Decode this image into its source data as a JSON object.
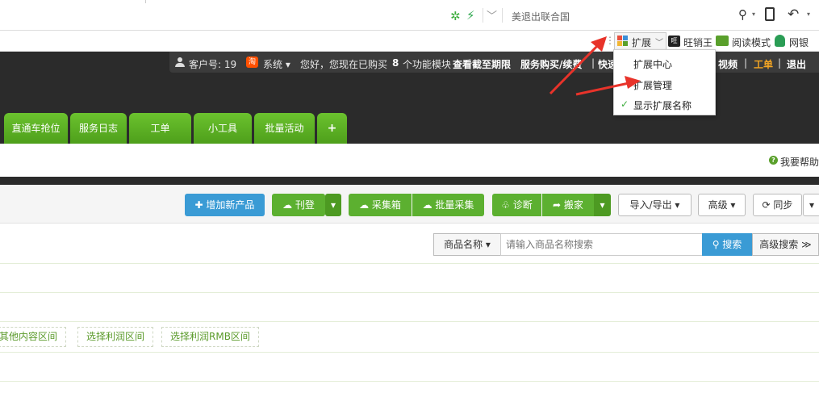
{
  "browser": {
    "search_text": "美退出联合国"
  },
  "extbar": {
    "ext_label": "扩展",
    "wangxiao": "旺销王",
    "read_mode": "阅读模式",
    "wangyin": "网银"
  },
  "ext_menu": {
    "items": [
      "扩展中心",
      "扩展管理",
      "显示扩展名称"
    ]
  },
  "infobar": {
    "customer": "客户号: 19",
    "system": "系统 ▾",
    "greeting": "您好，您现在已购买",
    "count": "8",
    "module_text": "个功能模块",
    "check_expiry": "查看截至期限",
    "service": "服务购买/续费",
    "quick": "快速",
    "video": "视频",
    "ticket": "工单",
    "logout": "退出",
    "sep": "|"
  },
  "tabs": [
    "直通车抢位",
    "服务日志",
    "工单",
    "小工具",
    "批量活动",
    "+"
  ],
  "help": "我要帮助",
  "toolbar": {
    "add_product": "增加新产品",
    "publish": "刊登",
    "collect_box": "采集箱",
    "batch_collect": "批量采集",
    "diagnose": "诊断",
    "move": "搬家",
    "import_export": "导入/导出 ▾",
    "advanced": "高级 ▾",
    "sync": "同步"
  },
  "search": {
    "field_select": "商品名称 ▾",
    "placeholder": "请输入商品名称搜索",
    "button": "搜索",
    "advanced": "高级搜索 ≫"
  },
  "filters": [
    "其他内容区间",
    "选择利润区间",
    "选择利润RMB区间"
  ],
  "colors": {
    "green": "#5cb030",
    "blue": "#3a9bd5",
    "dark": "#2b2b2b",
    "arrow": "#e8332a"
  }
}
